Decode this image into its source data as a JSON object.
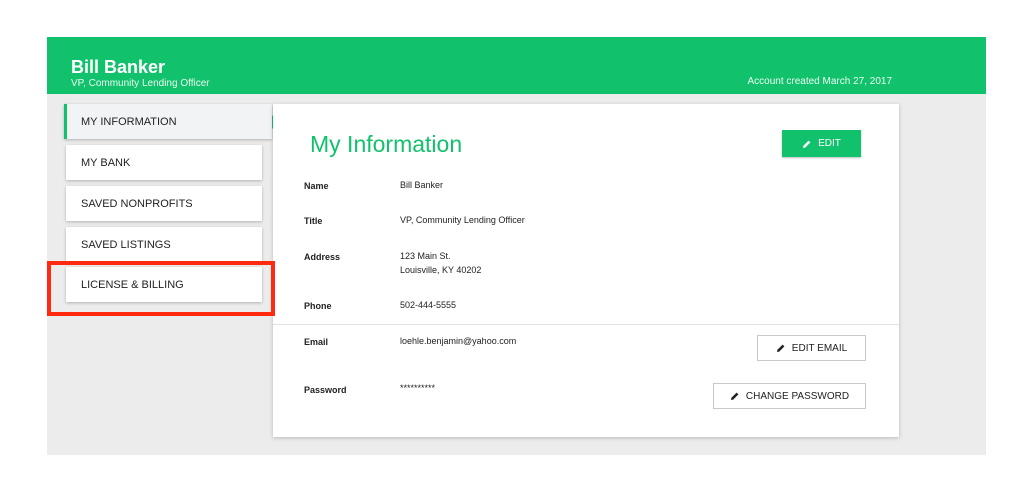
{
  "header": {
    "user_name": "Bill Banker",
    "user_title": "VP, Community Lending Officer",
    "account_created": "Account created March 27, 2017"
  },
  "sidebar": {
    "items": [
      {
        "label": "MY INFORMATION",
        "active": true
      },
      {
        "label": "MY BANK"
      },
      {
        "label": "SAVED NONPROFITS"
      },
      {
        "label": "SAVED LISTINGS"
      },
      {
        "label": "LICENSE & BILLING"
      }
    ]
  },
  "main": {
    "title": "My Information",
    "edit_label": "EDIT",
    "fields": {
      "name": {
        "label": "Name",
        "value": "Bill Banker"
      },
      "title": {
        "label": "Title",
        "value": "VP, Community Lending Officer"
      },
      "address": {
        "label": "Address",
        "line1": "123 Main St.",
        "line2": "Louisville, KY 40202"
      },
      "phone": {
        "label": "Phone",
        "value": "502-444-5555"
      },
      "email": {
        "label": "Email",
        "value": "loehle.benjamin@yahoo.com"
      },
      "password": {
        "label": "Password",
        "value": "**********"
      }
    },
    "edit_email_label": "EDIT EMAIL",
    "change_password_label": "CHANGE PASSWORD"
  },
  "colors": {
    "accent": "#12c16b",
    "highlight": "#ff2a10"
  },
  "icons": {
    "edit": "pencil-icon",
    "nav_indicator": "arrow-right-icon"
  }
}
